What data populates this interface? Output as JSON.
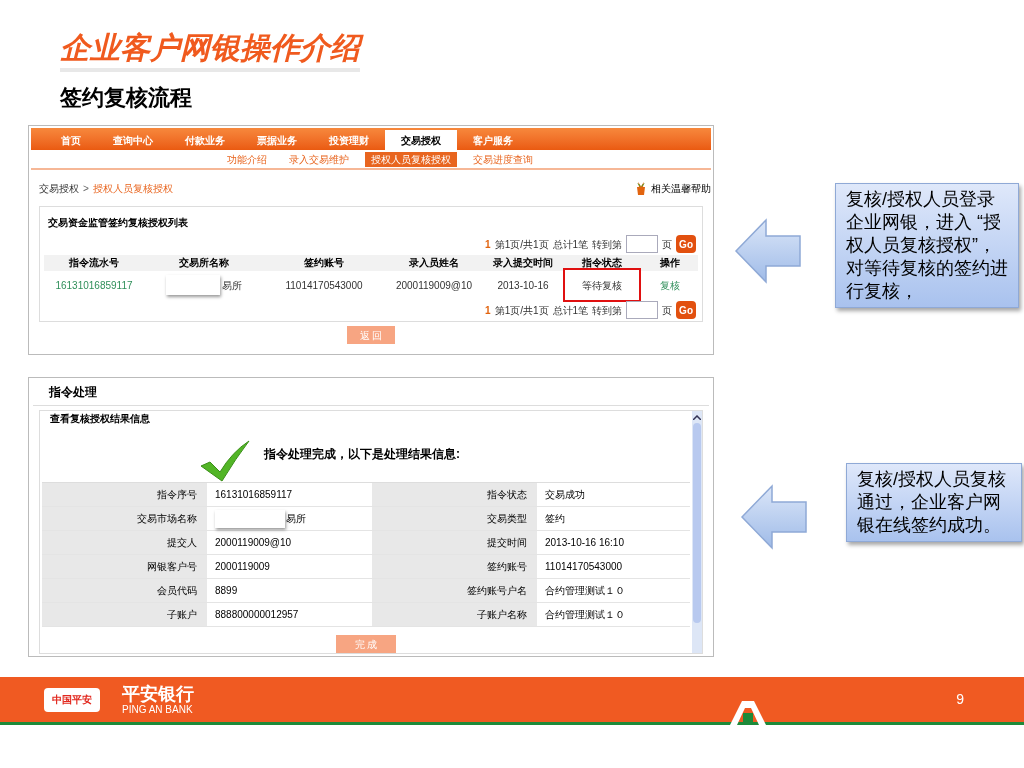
{
  "slide": {
    "title": "企业客户网银操作介绍",
    "subtitle": "签约复核流程",
    "page_number": "9"
  },
  "screen1": {
    "nav": [
      {
        "label": "首页",
        "selected": false
      },
      {
        "label": "查询中心",
        "selected": false
      },
      {
        "label": "付款业务",
        "selected": false
      },
      {
        "label": "票据业务",
        "selected": false
      },
      {
        "label": "投资理财",
        "selected": false
      },
      {
        "label": "交易授权",
        "selected": true
      },
      {
        "label": "客户服务",
        "selected": false
      }
    ],
    "subnav": [
      {
        "label": "功能介绍",
        "selected": false
      },
      {
        "label": "录入交易维护",
        "selected": false
      },
      {
        "label": "授权人员复核授权",
        "selected": true
      },
      {
        "label": "交易进度查询",
        "selected": false
      }
    ],
    "breadcrumb": [
      "交易授权",
      ">",
      "授权人员复核授权"
    ],
    "help": "相关温馨帮助",
    "list_title": "交易资金监管签约复核授权列表",
    "pagers": [
      {
        "current": "1",
        "page": "第1页/共1页",
        "total": "总计1笔",
        "goto": "转到第",
        "unit": "页",
        "go": "Go"
      },
      {
        "current": "1",
        "page": "第1页/共1页",
        "total": "总计1笔",
        "goto": "转到第",
        "unit": "页",
        "go": "Go"
      }
    ],
    "columns": [
      "指令流水号",
      "交易所名称",
      "签约账号",
      "录入员姓名",
      "录入提交时间",
      "指令状态",
      "操作"
    ],
    "rows": [
      {
        "cells": [
          {
            "text": "16131016859117",
            "kind": "link",
            "outlined": false
          },
          {
            "text": "易所",
            "kind": "redacted",
            "outlined": false
          },
          {
            "text": "11014170543000",
            "kind": "text",
            "outlined": false
          },
          {
            "text": "2000119009@10",
            "kind": "text",
            "outlined": false
          },
          {
            "text": "2013-10-16",
            "kind": "text",
            "outlined": false
          },
          {
            "text": "等待复核",
            "kind": "text",
            "outlined": true
          },
          {
            "text": "复核",
            "kind": "link",
            "outlined": false
          }
        ]
      }
    ],
    "back_button": "返 回"
  },
  "screen2": {
    "title": "指令处理",
    "section_title": "查看复核授权结果信息",
    "message": "指令处理完成，以下是处理结果信息:",
    "rows": [
      {
        "left": {
          "label": "指令序号",
          "value": "16131016859117",
          "redacted": false
        },
        "right": {
          "label": "指令状态",
          "value": "交易成功"
        }
      },
      {
        "left": {
          "label": "交易市场名称",
          "value": "易所",
          "redacted": true
        },
        "right": {
          "label": "交易类型",
          "value": "签约"
        }
      },
      {
        "left": {
          "label": "提交人",
          "value": "2000119009@10",
          "redacted": false
        },
        "right": {
          "label": "提交时间",
          "value": "2013-10-16 16:10"
        }
      },
      {
        "left": {
          "label": "网银客户号",
          "value": "2000119009",
          "redacted": false
        },
        "right": {
          "label": "签约账号",
          "value": "11014170543000"
        }
      },
      {
        "left": {
          "label": "会员代码",
          "value": "8899",
          "redacted": false
        },
        "right": {
          "label": "签约账号户名",
          "value": "合约管理测试１０"
        }
      },
      {
        "left": {
          "label": "子账户",
          "value": "888800000012957",
          "redacted": false
        },
        "right": {
          "label": "子账户名称",
          "value": "合约管理测试１０"
        }
      }
    ],
    "button": "完 成"
  },
  "callouts": [
    {
      "text": "复核/授权人员登录企业网银，进入 “授权人员复核授权”，对等待复核的签约进行复核，"
    },
    {
      "text": "复核/授权人员复核通过，企业客户网银在线签约成功。"
    }
  ],
  "footer": {
    "badge": "中国平安",
    "brand": "平安银行",
    "brand_en": "PING AN BANK"
  }
}
